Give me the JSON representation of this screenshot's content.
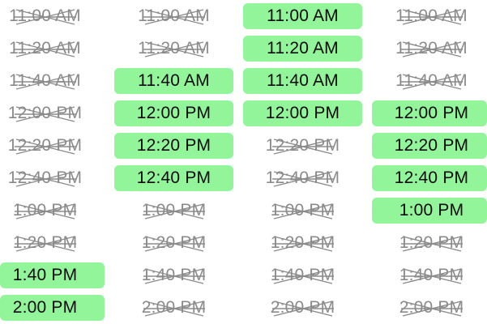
{
  "colors": {
    "available_bg": "#93f59a",
    "available_text": "#0a0a0a",
    "unavailable_text": "#8b8b8b"
  },
  "columns": [
    {
      "slots": [
        {
          "time": "11:00 AM",
          "available": false
        },
        {
          "time": "11:20 AM",
          "available": false
        },
        {
          "time": "11:40 AM",
          "available": false
        },
        {
          "time": "12:00 PM",
          "available": false
        },
        {
          "time": "12:20 PM",
          "available": false
        },
        {
          "time": "12:40 PM",
          "available": false
        },
        {
          "time": "1:00 PM",
          "available": false
        },
        {
          "time": "1:20 PM",
          "available": false
        },
        {
          "time": "1:40 PM",
          "available": true
        },
        {
          "time": "2:00 PM",
          "available": true
        }
      ]
    },
    {
      "slots": [
        {
          "time": "11:00 AM",
          "available": false
        },
        {
          "time": "11:20 AM",
          "available": false
        },
        {
          "time": "11:40 AM",
          "available": true
        },
        {
          "time": "12:00 PM",
          "available": true
        },
        {
          "time": "12:20 PM",
          "available": true
        },
        {
          "time": "12:40 PM",
          "available": true
        },
        {
          "time": "1:00 PM",
          "available": false
        },
        {
          "time": "1:20 PM",
          "available": false
        },
        {
          "time": "1:40 PM",
          "available": false
        },
        {
          "time": "2:00 PM",
          "available": false
        }
      ]
    },
    {
      "slots": [
        {
          "time": "11:00 AM",
          "available": true
        },
        {
          "time": "11:20 AM",
          "available": true
        },
        {
          "time": "11:40 AM",
          "available": true
        },
        {
          "time": "12:00 PM",
          "available": true
        },
        {
          "time": "12:20 PM",
          "available": false
        },
        {
          "time": "12:40 PM",
          "available": false
        },
        {
          "time": "1:00 PM",
          "available": false
        },
        {
          "time": "1:20 PM",
          "available": false
        },
        {
          "time": "1:40 PM",
          "available": false
        },
        {
          "time": "2:00 PM",
          "available": false
        }
      ]
    },
    {
      "slots": [
        {
          "time": "11:00 AM",
          "available": false
        },
        {
          "time": "11:20 AM",
          "available": false
        },
        {
          "time": "11:40 AM",
          "available": false
        },
        {
          "time": "12:00 PM",
          "available": true
        },
        {
          "time": "12:20 PM",
          "available": true
        },
        {
          "time": "12:40 PM",
          "available": true
        },
        {
          "time": "1:00 PM",
          "available": true
        },
        {
          "time": "1:20 PM",
          "available": false
        },
        {
          "time": "1:40 PM",
          "available": false
        },
        {
          "time": "2:00 PM",
          "available": false
        }
      ]
    }
  ]
}
